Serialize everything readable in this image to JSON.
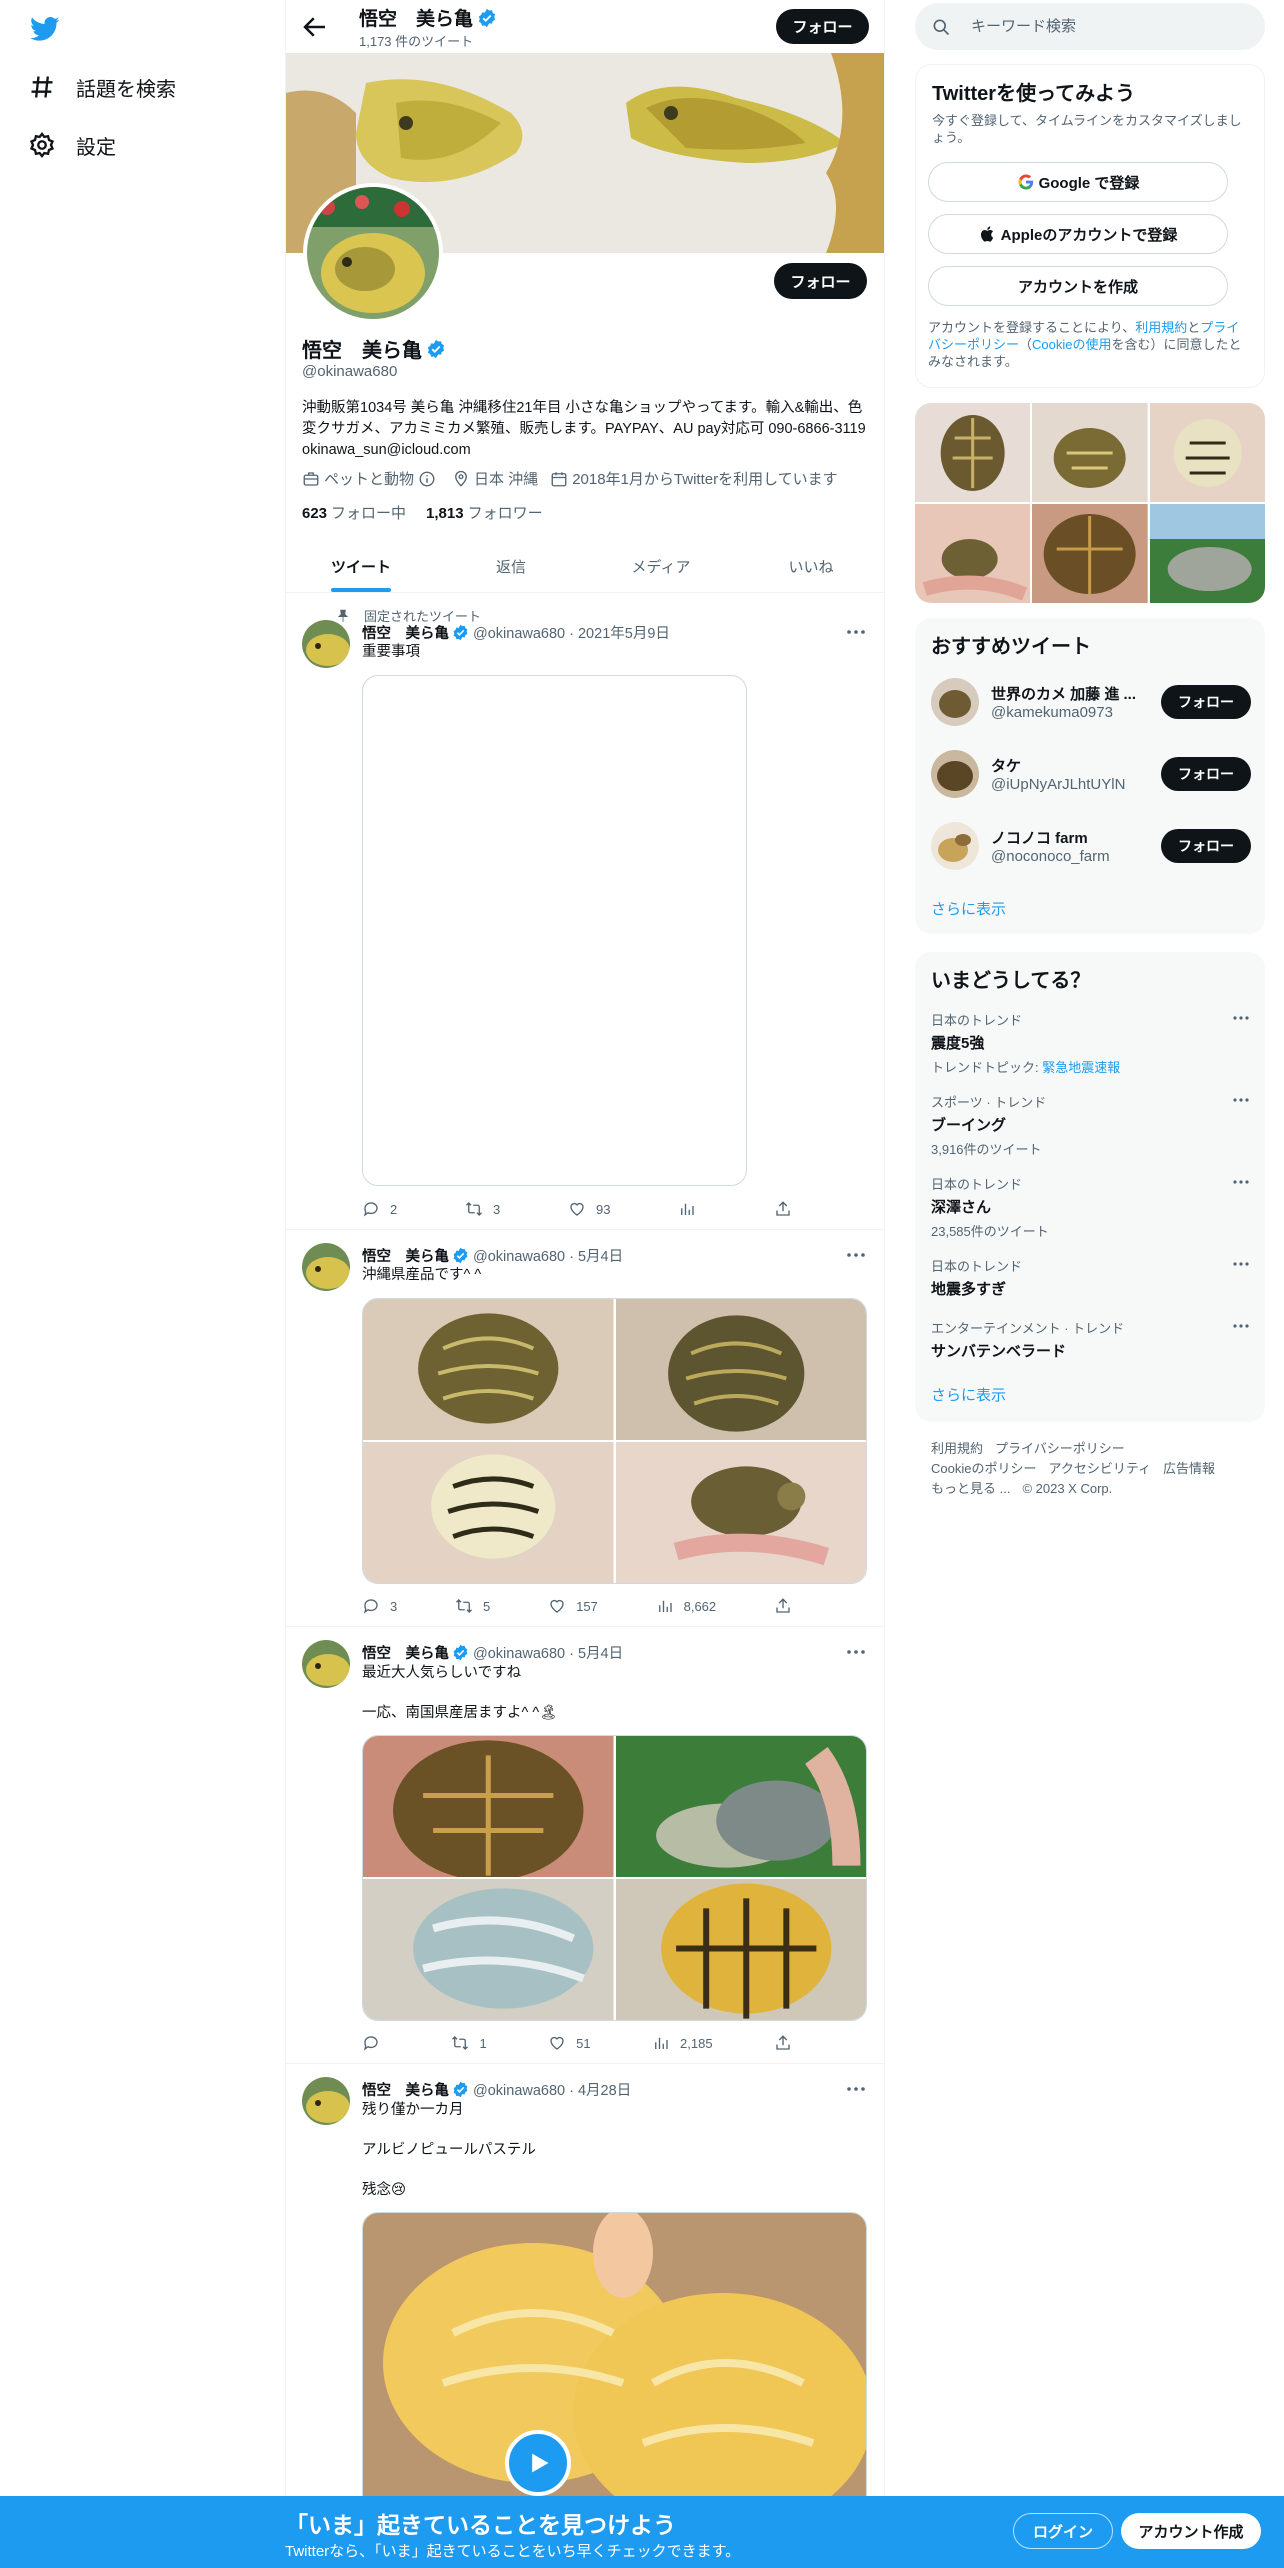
{
  "nav": {
    "logo": "twitter-bird-icon",
    "items": [
      {
        "label": "話題を検索",
        "icon": "hashtag-icon"
      },
      {
        "label": "設定",
        "icon": "gear-icon"
      }
    ]
  },
  "profile": {
    "header_name": "悟空　美ら亀",
    "tweet_count": "1,173 件のツイート",
    "follow_label": "フォロー",
    "name": "悟空　美ら亀",
    "handle": "@okinawa680",
    "bio": "沖動販第1034号 美ら亀 沖縄移住21年目 小さな亀ショップやってます。輸入&輸出、色変クサガメ、アカミミカメ繁殖、販売します。PAYPAY、AU pay対応可 090-6866-3119 okinawa_sun@icloud.com",
    "category": "ペットと動物",
    "location": "日本 沖縄",
    "joined": "2018年1月からTwitterを利用しています",
    "following_count": "623",
    "following_label": "フォロー中",
    "followers_count": "1,813",
    "followers_label": "フォロワー"
  },
  "tabs": [
    {
      "label": "ツイート",
      "active": true
    },
    {
      "label": "返信"
    },
    {
      "label": "メディア"
    },
    {
      "label": "いいね"
    }
  ],
  "tweets": [
    {
      "pinned_label": "固定されたツイート",
      "name": "悟空　美ら亀",
      "meta": "@okinawa680 · 2021年5月9日",
      "text": "重要事項",
      "replies": "2",
      "retweets": "3",
      "likes": "93",
      "views": ""
    },
    {
      "name": "悟空　美ら亀",
      "meta": "@okinawa680 · 5月4日",
      "text": "沖縄県産品です^ ^",
      "replies": "3",
      "retweets": "5",
      "likes": "157",
      "views": "8,662"
    },
    {
      "name": "悟空　美ら亀",
      "meta": "@okinawa680 · 5月4日",
      "text": "最近大人気らしいですね\n\n一応、南国県産居ますよ^ ^🏝",
      "replies": "",
      "retweets": "1",
      "likes": "51",
      "views": "2,185"
    },
    {
      "name": "悟空　美ら亀",
      "meta": "@okinawa680 · 4月28日",
      "text": "残り僅か一カ月\n\nアルビノピュールパステル\n\n残念😢"
    }
  ],
  "right": {
    "search_placeholder": "キーワード検索",
    "signup": {
      "title": "Twitterを使ってみよう",
      "subtitle": "今すぐ登録して、タイムラインをカスタマイズしましょう。",
      "google": "Google で登録",
      "apple": "Appleのアカウントで登録",
      "create": "アカウントを作成",
      "terms_prefix": "アカウントを登録することにより、",
      "terms_link1": "利用規約",
      "terms_and": "と",
      "terms_link2": "プライバシーポリシー",
      "terms_paren_open": "（",
      "terms_link3": "Cookieの使用",
      "terms_suffix": "を含む）に同意したとみなされます。"
    },
    "who_to_follow": {
      "title": "おすすめツイート",
      "users": [
        {
          "name": "世界のカメ 加藤 進 ...",
          "handle": "@kamekuma0973"
        },
        {
          "name": "タケ",
          "handle": "@iUpNyArJLhtUYlN"
        },
        {
          "name": "ノコノコ farm",
          "handle": "@noconoco_farm"
        }
      ],
      "follow_label": "フォロー",
      "more": "さらに表示"
    },
    "trends": {
      "title": "いまどうしてる？",
      "items": [
        {
          "context": "日本のトレンド",
          "title": "震度5強",
          "sub_prefix": "トレンドトピック: ",
          "sub_link": "緊急地震速報"
        },
        {
          "context": "スポーツ · トレンド",
          "title": "ブーイング",
          "sub": "3,916件のツイート"
        },
        {
          "context": "日本のトレンド",
          "title": "深澤さん",
          "sub": "23,585件のツイート"
        },
        {
          "context": "日本のトレンド",
          "title": "地震多すぎ"
        },
        {
          "context": "エンターテインメント · トレンド",
          "title": "サンバテンベラード"
        }
      ],
      "more": "さらに表示"
    },
    "footer": {
      "terms": "利用規約",
      "privacy": "プライバシーポリシー",
      "cookie": "Cookieのポリシー",
      "accessibility": "アクセシビリティ",
      "ads": "広告情報",
      "more": "もっと見る ...",
      "copyright": "© 2023 X Corp."
    }
  },
  "bottom": {
    "title": "「いま」起きていることを見つけよう",
    "subtitle": "Twitterなら、「いま」起きていることをいち早くチェックできます。",
    "login": "ログイン",
    "signup": "アカウント作成"
  },
  "colors": {
    "accent": "#1d9bf0",
    "text": "#0f1419",
    "muted": "#536471"
  }
}
